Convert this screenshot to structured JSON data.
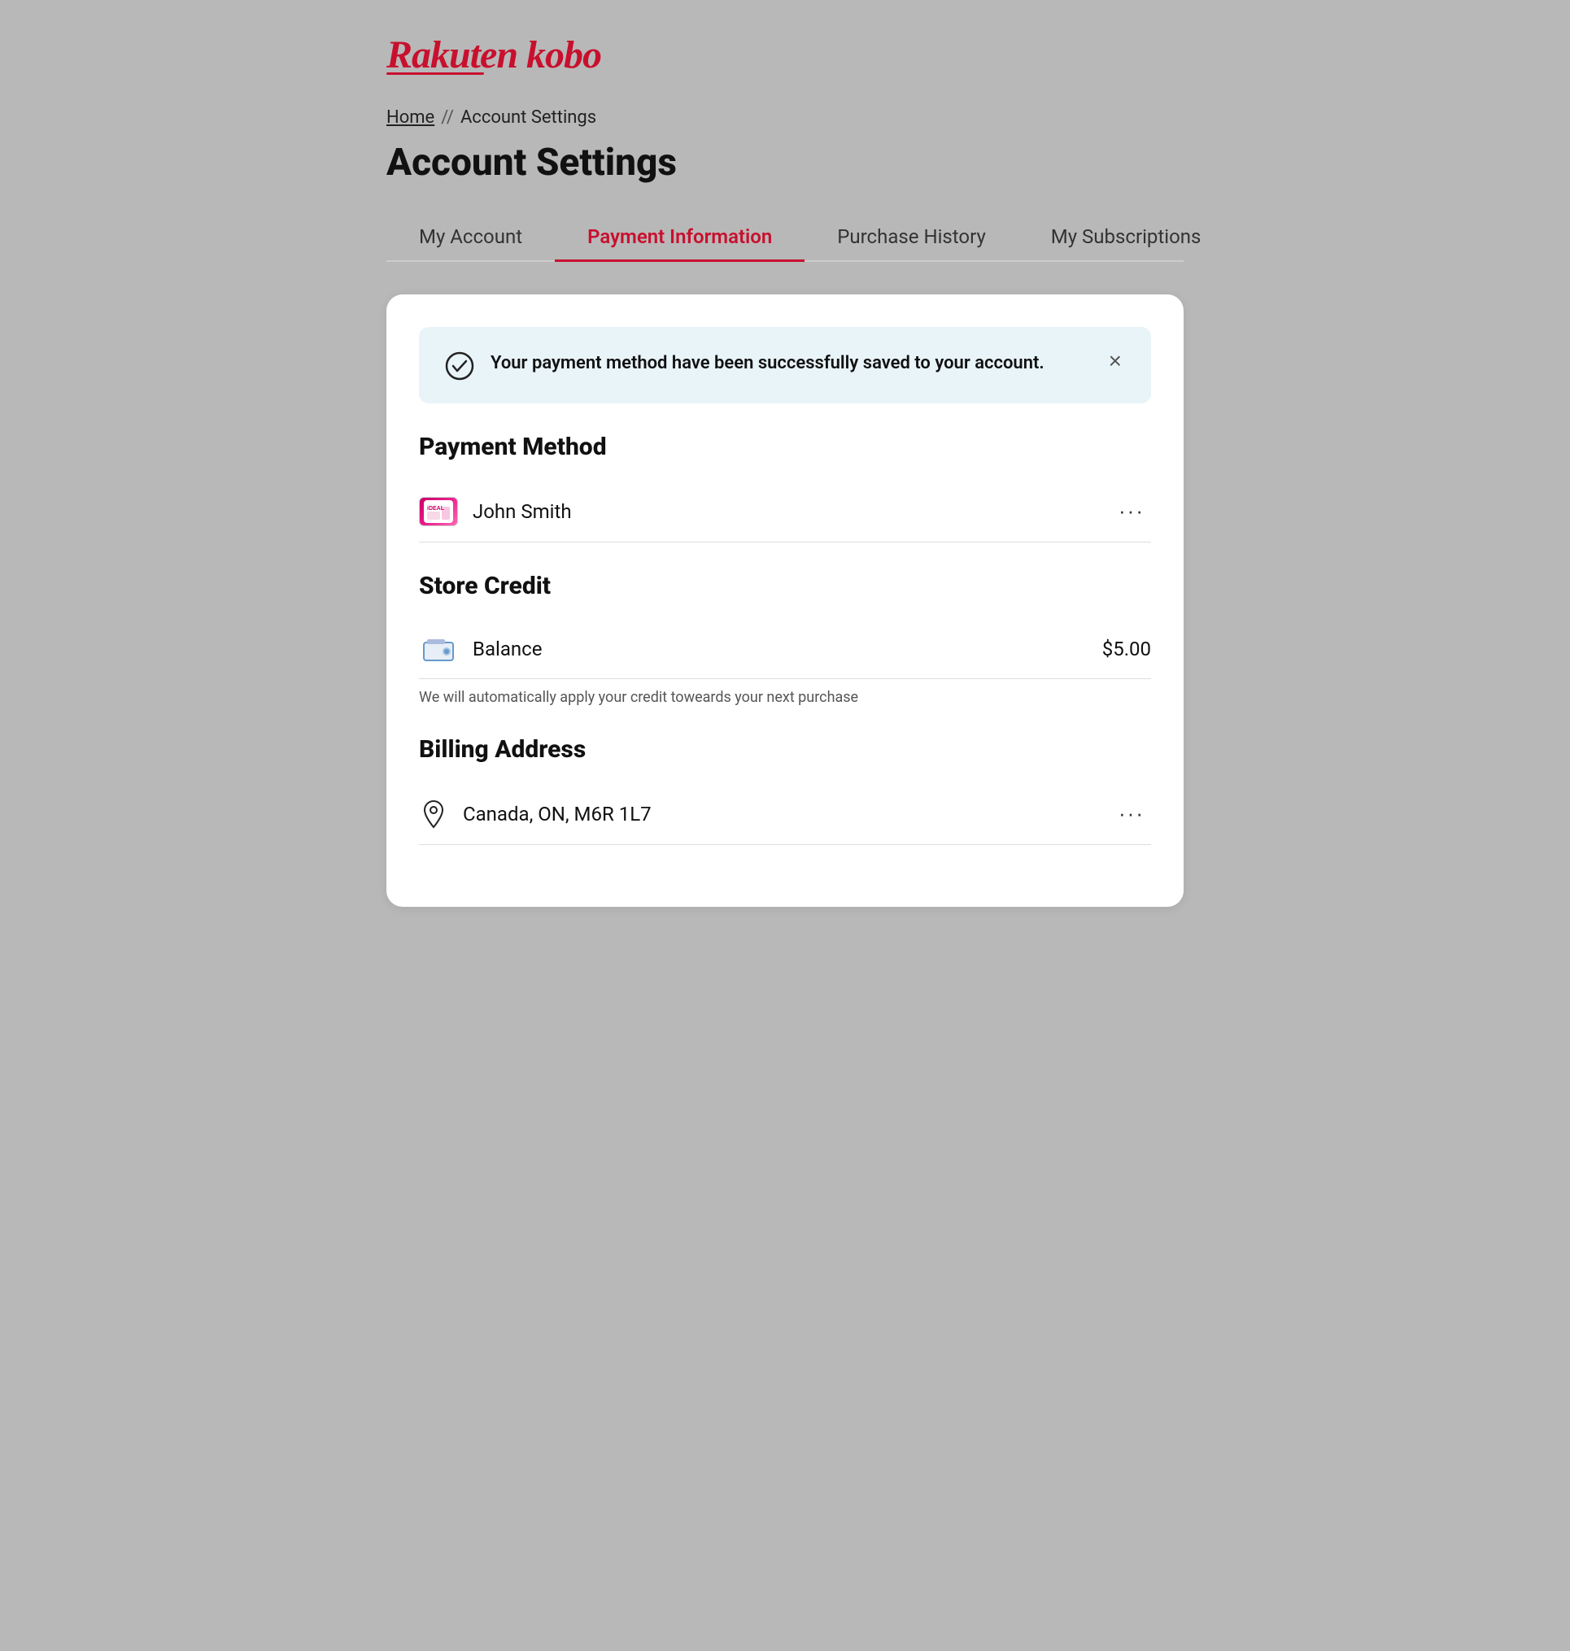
{
  "logo": {
    "text": "Rakuten kobo"
  },
  "breadcrumb": {
    "home": "Home",
    "separator": "//",
    "current": "Account Settings"
  },
  "page": {
    "title": "Account Settings"
  },
  "tabs": [
    {
      "id": "my-account",
      "label": "My Account",
      "active": false
    },
    {
      "id": "payment-information",
      "label": "Payment Information",
      "active": true
    },
    {
      "id": "purchase-history",
      "label": "Purchase History",
      "active": false
    },
    {
      "id": "my-subscriptions",
      "label": "My Subscriptions",
      "active": false
    }
  ],
  "success_banner": {
    "message": "Your payment method have been successfully saved to your account.",
    "close_label": "×"
  },
  "payment_method": {
    "title": "Payment Method",
    "items": [
      {
        "icon": "ideal",
        "name": "John Smith",
        "more_label": "···"
      }
    ]
  },
  "store_credit": {
    "title": "Store Credit",
    "balance_label": "Balance",
    "balance_amount": "$5.00",
    "note": "We will automatically apply your credit toweards your next purchase"
  },
  "billing_address": {
    "title": "Billing Address",
    "items": [
      {
        "address": "Canada, ON, M6R 1L7",
        "more_label": "···"
      }
    ]
  }
}
